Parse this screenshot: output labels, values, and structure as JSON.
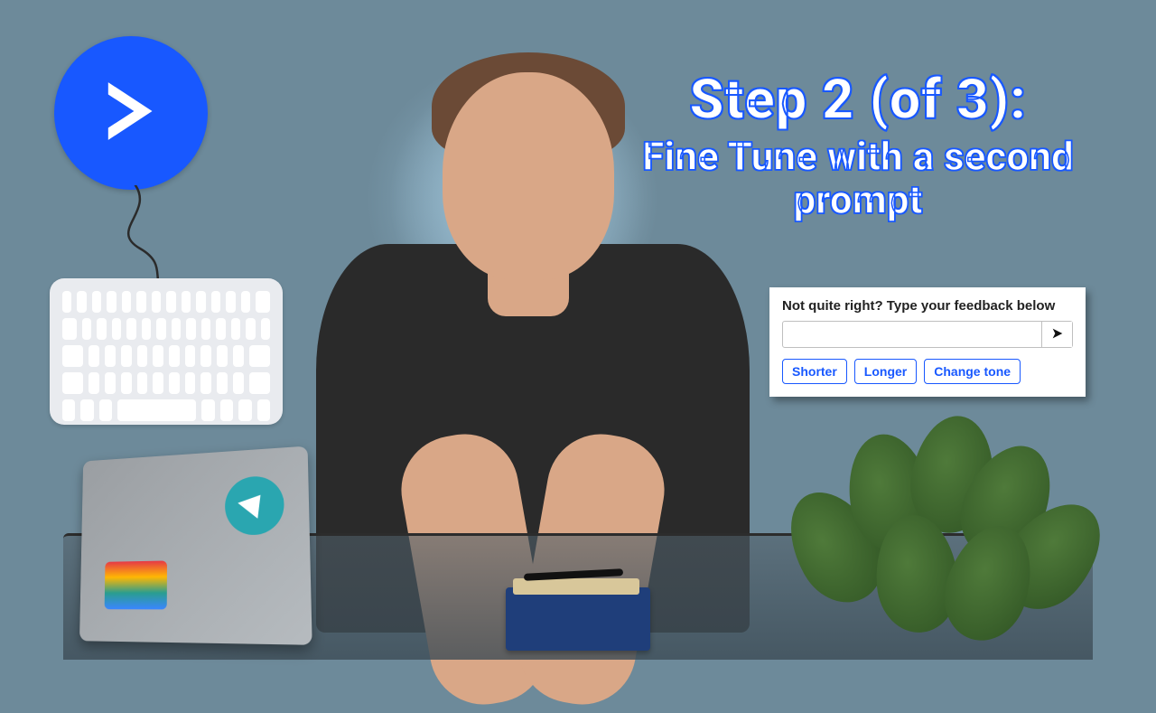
{
  "logo": {
    "name": "activecampaign-logo"
  },
  "title": {
    "line1": "Step 2 (of 3):",
    "line2": "Fine Tune with a second prompt"
  },
  "feedback": {
    "label": "Not quite right? Type your feedback below",
    "input_value": "",
    "input_placeholder": "",
    "send_label": "Send",
    "chips": [
      "Shorter",
      "Longer",
      "Change tone"
    ]
  },
  "colors": {
    "brand_blue": "#1858ff",
    "background": "#6d8a9a"
  }
}
